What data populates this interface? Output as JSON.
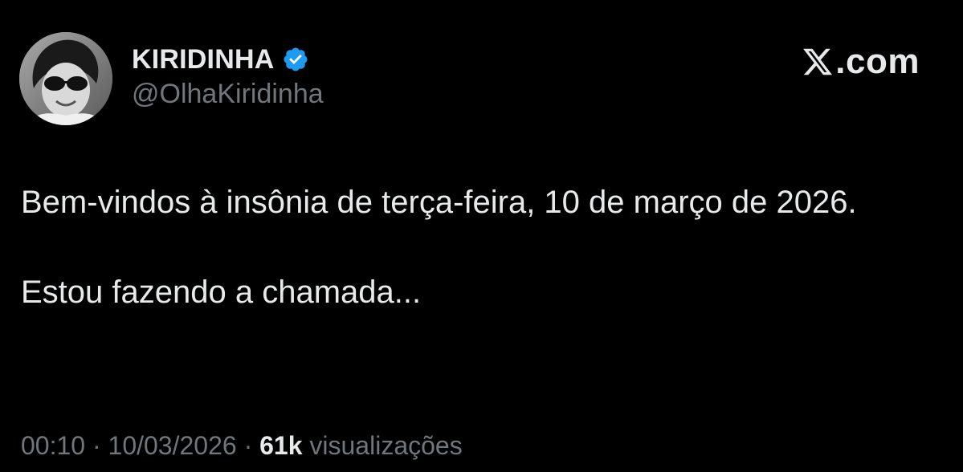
{
  "author": {
    "display_name": "KIRIDINHA",
    "handle": "@OlhaKiridinha",
    "verified_icon": "verified-badge-icon",
    "verified_color": "#1d9bf0",
    "avatar_icon": "avatar-photo"
  },
  "source": {
    "logo_icon": "x-logo-icon",
    "text": ".com"
  },
  "tweet": {
    "paragraphs": [
      "Bem-vindos à insônia de terça-feira, 10 de março de 2026.",
      "Estou fazendo a chamada..."
    ]
  },
  "meta": {
    "time": "00:10",
    "separator": "·",
    "date": "10/03/2026",
    "views_count": "61k",
    "views_label": "visualizações"
  },
  "colors": {
    "background": "#000000",
    "primary_text": "#e7e9ea",
    "secondary_text": "#71767b",
    "accent": "#1d9bf0"
  }
}
